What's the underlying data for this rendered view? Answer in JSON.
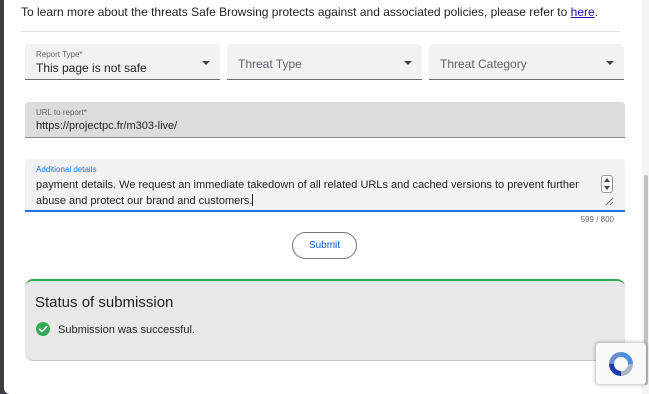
{
  "intro": {
    "text": "To learn more about the threats Safe Browsing protects against and associated policies, please refer to ",
    "link": "here",
    "end": "."
  },
  "form": {
    "report_type": {
      "label": "Report Type*",
      "value": "This page is not safe"
    },
    "threat_type": {
      "placeholder": "Threat Type"
    },
    "threat_category": {
      "placeholder": "Threat Category"
    },
    "url": {
      "label": "URL to report*",
      "value": "https://projectpc.fr/m303-live/"
    },
    "details": {
      "label": "Additional details",
      "value": "payment details. We request an immediate takedown of all related URLs and cached versions to prevent further abuse and protect our brand and customers.",
      "counter": "599 / 800"
    },
    "submit_label": "Submit"
  },
  "status": {
    "title": "Status of submission",
    "message": "Submission was successful.",
    "icon": "check-circle-icon"
  },
  "colors": {
    "accent": "#1a73e8",
    "success": "#34a853",
    "link": "#1a0dab"
  },
  "recaptcha": {
    "icon": "recaptcha-icon"
  }
}
